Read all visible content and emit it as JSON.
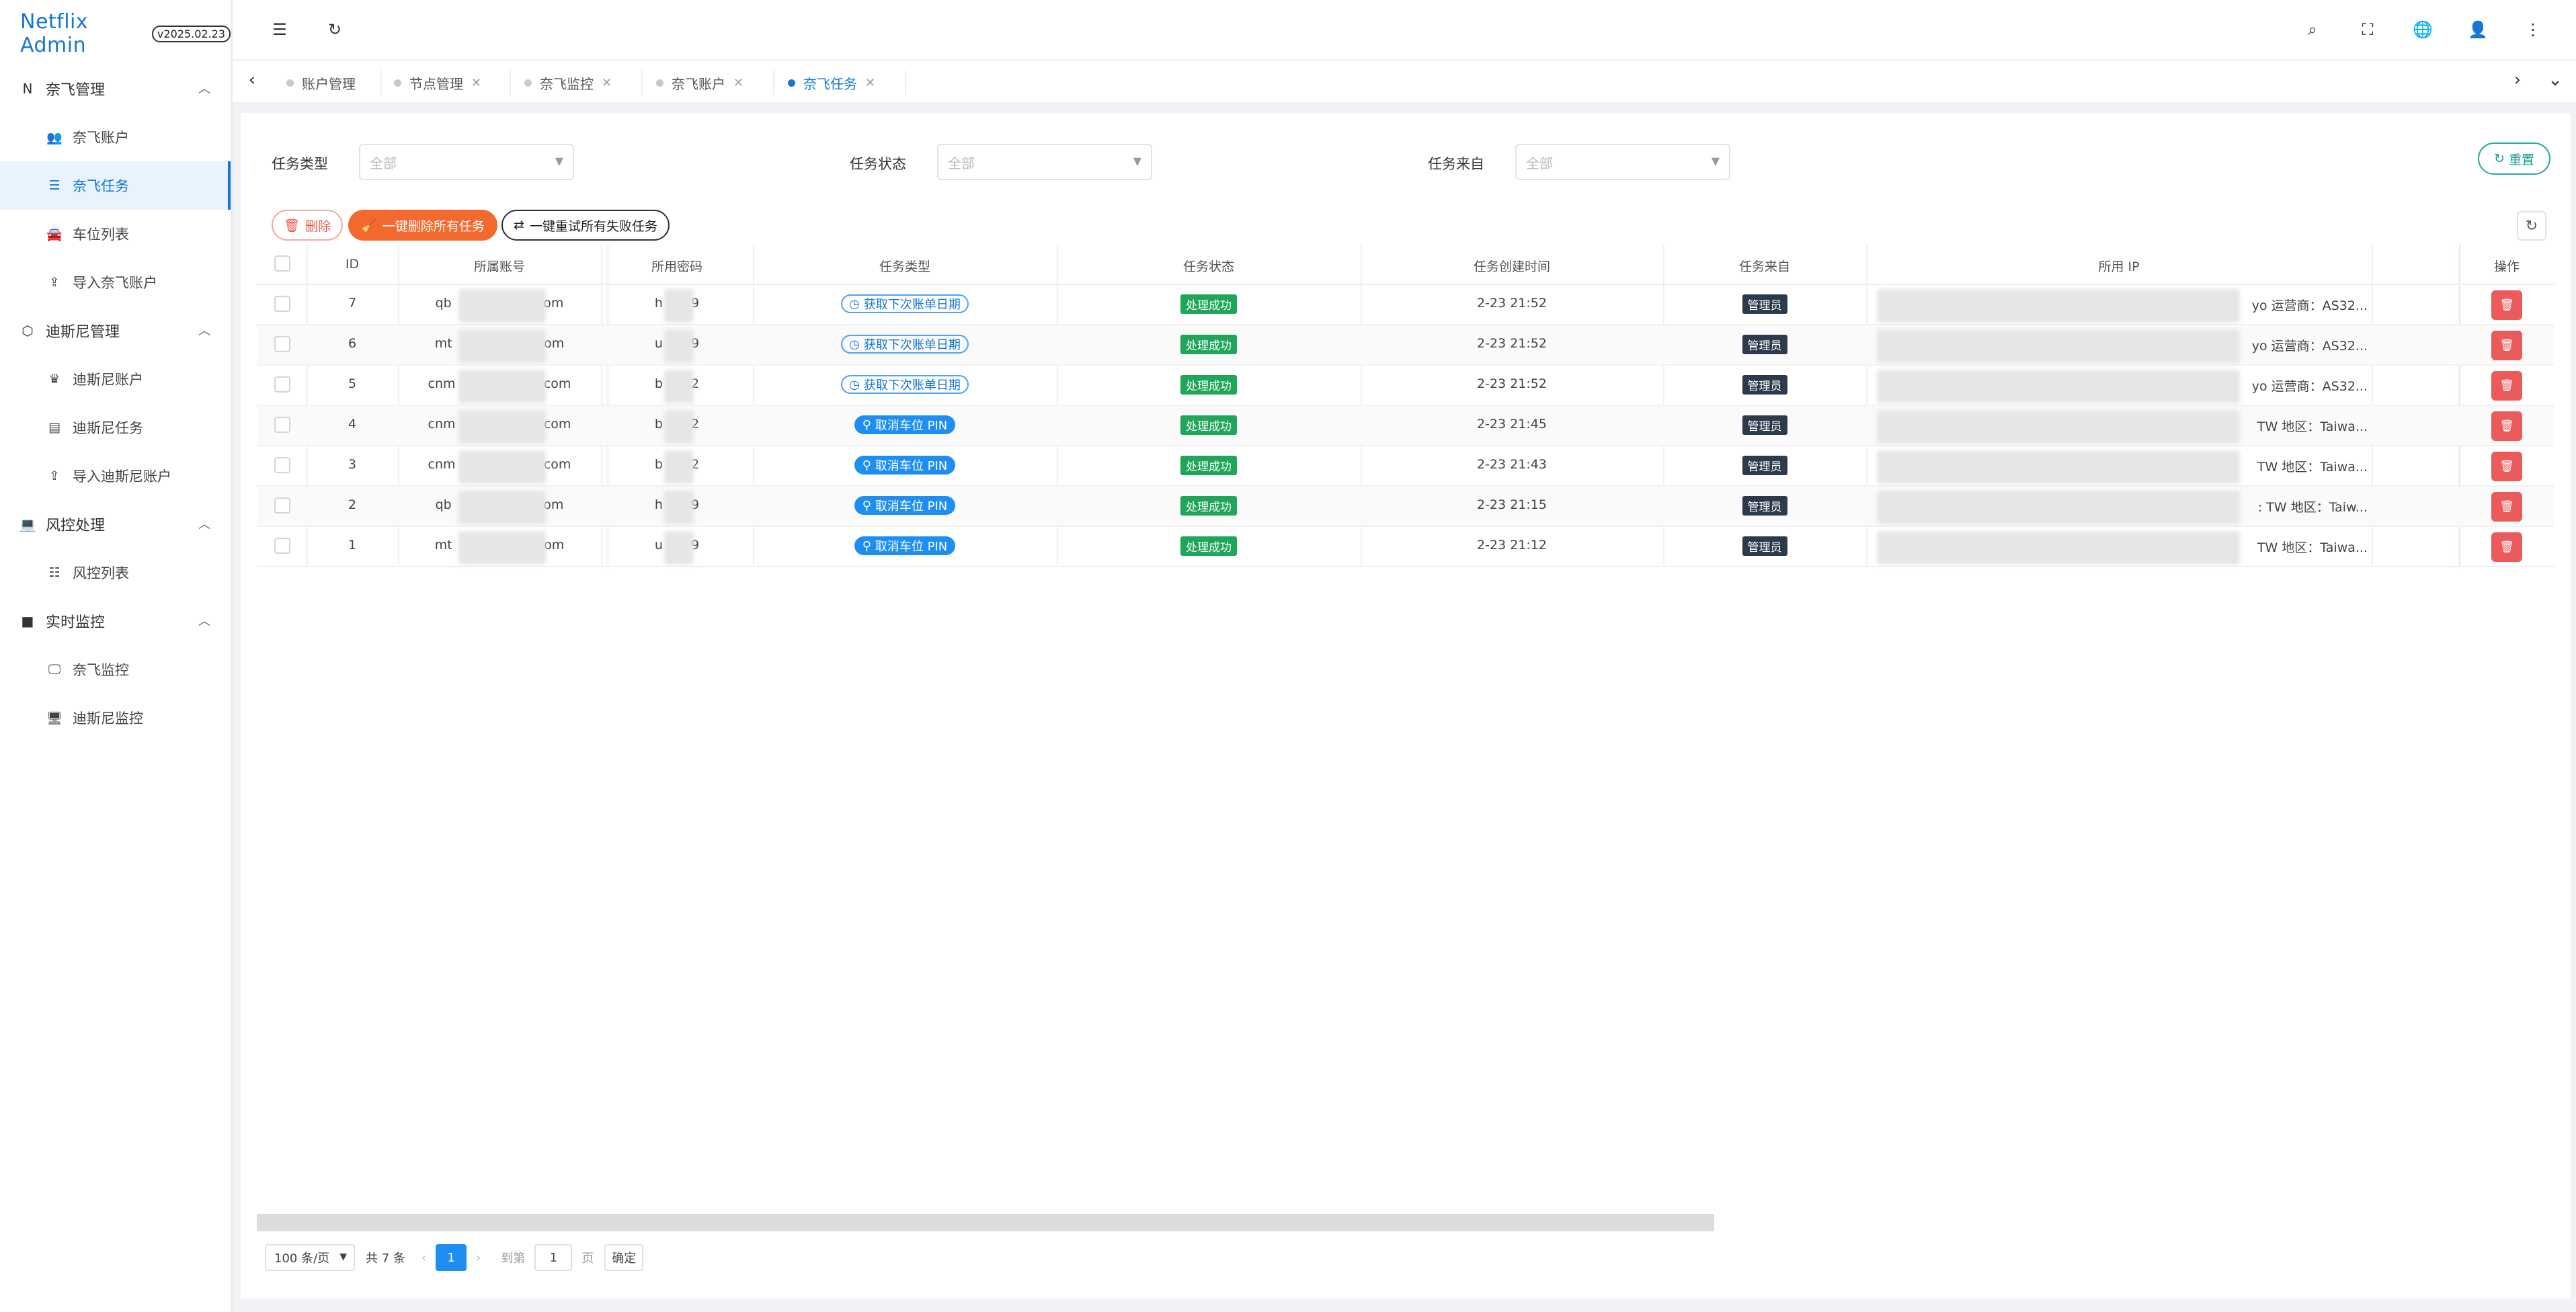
{
  "brand": {
    "title": "Netflix Admin",
    "version": "v2025.02.23"
  },
  "sidebar": {
    "groups": [
      {
        "icon": "N",
        "label": "奈飞管理",
        "items": [
          {
            "icon": "users-icon",
            "label": "奈飞账户"
          },
          {
            "icon": "list-icon",
            "label": "奈飞任务"
          },
          {
            "icon": "car-icon",
            "label": "车位列表"
          },
          {
            "icon": "upload-icon",
            "label": "导入奈飞账户"
          }
        ]
      },
      {
        "icon": "cube-icon",
        "label": "迪斯尼管理",
        "items": [
          {
            "icon": "crown-icon",
            "label": "迪斯尼账户"
          },
          {
            "icon": "doc-icon",
            "label": "迪斯尼任务"
          },
          {
            "icon": "upload-icon",
            "label": "导入迪斯尼账户"
          }
        ]
      },
      {
        "icon": "laptop-icon",
        "label": "风控处理",
        "items": [
          {
            "icon": "list-icon",
            "label": "风控列表"
          }
        ]
      },
      {
        "icon": "video-icon",
        "label": "实时监控",
        "items": [
          {
            "icon": "monitor-icon",
            "label": "奈飞监控"
          },
          {
            "icon": "monitor-icon",
            "label": "迪斯尼监控"
          }
        ]
      }
    ]
  },
  "tabs": [
    {
      "label": "账户管理",
      "closable": false,
      "active": false
    },
    {
      "label": "节点管理",
      "closable": true,
      "active": false
    },
    {
      "label": "奈飞监控",
      "closable": true,
      "active": false
    },
    {
      "label": "奈飞账户",
      "closable": true,
      "active": false
    },
    {
      "label": "奈飞任务",
      "closable": true,
      "active": true
    }
  ],
  "filters": {
    "task_type": {
      "label": "任务类型",
      "value": "全部"
    },
    "task_status": {
      "label": "任务状态",
      "value": "全部"
    },
    "task_source": {
      "label": "任务来自",
      "value": "全部"
    },
    "reset_label": "重置"
  },
  "actions": {
    "delete": "删除",
    "delete_all": "一键删除所有任务",
    "retry_failed": "一键重试所有失败任务"
  },
  "table": {
    "columns": [
      "ID",
      "所属账号",
      "所用密码",
      "任务类型",
      "任务状态",
      "任务创建时间",
      "任务来自",
      "所用 IP",
      "操作"
    ],
    "rows": [
      {
        "id": "7",
        "acc_pre": "qb",
        "acc_suf": ".com",
        "pw_pre": "h",
        "pw_suf": "9",
        "type": "获取下次账单日期",
        "type_style": "outline",
        "status": "处理成功",
        "time": "2-23 21:52",
        "source": "管理员",
        "ip": "yo 运营商：AS32..."
      },
      {
        "id": "6",
        "acc_pre": "mt",
        "acc_suf": ".com",
        "pw_pre": "u",
        "pw_suf": "9",
        "type": "获取下次账单日期",
        "type_style": "outline",
        "status": "处理成功",
        "time": "2-23 21:52",
        "source": "管理员",
        "ip": "yo 运营商：AS32..."
      },
      {
        "id": "5",
        "acc_pre": "cnm",
        "acc_suf": "i.com",
        "pw_pre": "b",
        "pw_suf": "2",
        "type": "获取下次账单日期",
        "type_style": "outline",
        "status": "处理成功",
        "time": "2-23 21:52",
        "source": "管理员",
        "ip": "yo 运营商：AS32..."
      },
      {
        "id": "4",
        "acc_pre": "cnm",
        "acc_suf": "i.com",
        "pw_pre": "b",
        "pw_suf": "2",
        "type": "取消车位 PIN",
        "type_style": "solid",
        "status": "处理成功",
        "time": "2-23 21:45",
        "source": "管理员",
        "ip": "TW 地区：Taiwa..."
      },
      {
        "id": "3",
        "acc_pre": "cnm",
        "acc_suf": "i.com",
        "pw_pre": "b",
        "pw_suf": "2",
        "type": "取消车位 PIN",
        "type_style": "solid",
        "status": "处理成功",
        "time": "2-23 21:43",
        "source": "管理员",
        "ip": "TW 地区：Taiwa..."
      },
      {
        "id": "2",
        "acc_pre": "qb",
        "acc_suf": ".com",
        "pw_pre": "h",
        "pw_suf": "9",
        "type": "取消车位 PIN",
        "type_style": "solid",
        "status": "处理成功",
        "time": "2-23 21:15",
        "source": "管理员",
        "ip": ": TW 地区：Taiw..."
      },
      {
        "id": "1",
        "acc_pre": "mt",
        "acc_suf": ".com",
        "pw_pre": "u",
        "pw_suf": "9",
        "type": "取消车位 PIN",
        "type_style": "solid",
        "status": "处理成功",
        "time": "2-23 21:12",
        "source": "管理员",
        "ip": "TW 地区：Taiwa..."
      }
    ]
  },
  "pagination": {
    "page_size": "100 条/页",
    "total": "共 7 条",
    "current": "1",
    "goto_label": "到第",
    "goto_value": "1",
    "page_unit": "页",
    "confirm": "确定"
  },
  "colors": {
    "primary": "#1677d2",
    "danger": "#ec5b5b",
    "orange": "#f26a2e",
    "success": "#20a65a",
    "dark_tag": "#2d3a4b",
    "teal": "#2aa8a0"
  }
}
